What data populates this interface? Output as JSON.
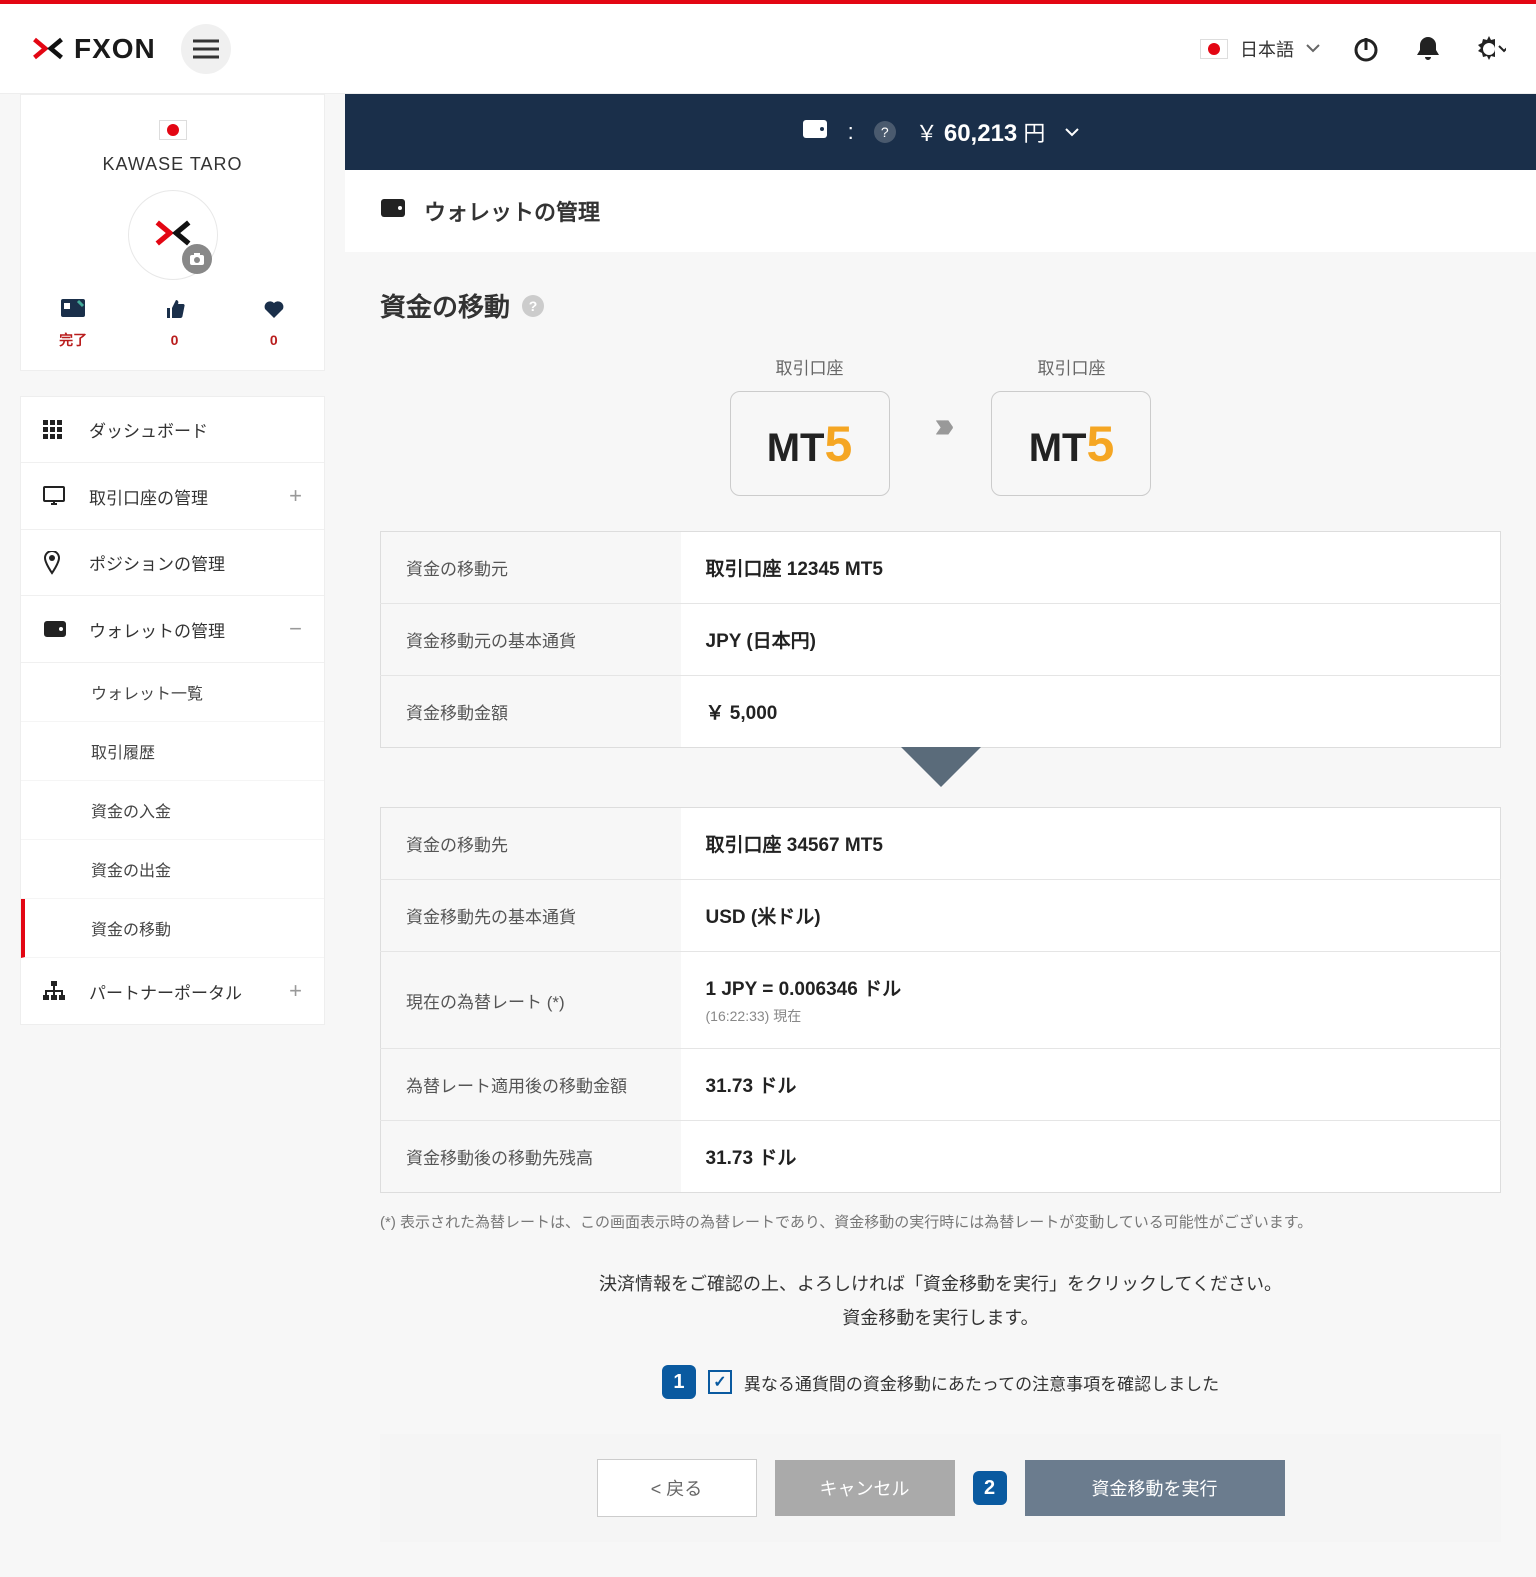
{
  "header": {
    "brand": "FXON",
    "language": "日本語"
  },
  "profile": {
    "name": "KAWASE TARO",
    "stats": {
      "complete_label": "完了",
      "thumbs": "0",
      "hearts": "0"
    }
  },
  "nav": {
    "dashboard": "ダッシュボード",
    "accounts": "取引口座の管理",
    "positions": "ポジションの管理",
    "wallet": "ウォレットの管理",
    "partner": "パートナーポータル",
    "sub": {
      "wallet_list": "ウォレット一覧",
      "history": "取引履歴",
      "deposit": "資金の入金",
      "withdrawal": "資金の出金",
      "transfer": "資金の移動"
    }
  },
  "balance": {
    "colon": ":",
    "currency_symbol": "￥",
    "amount": "60,213",
    "currency": "円"
  },
  "page": {
    "title": "ウォレットの管理",
    "section_title": "資金の移動"
  },
  "transfer": {
    "source_label": "取引口座",
    "dest_label": "取引口座",
    "platform_prefix": "MT",
    "platform_num": "5"
  },
  "source_table": {
    "account_label": "資金の移動元",
    "account_value": "取引口座 12345 MT5",
    "currency_label": "資金移動元の基本通貨",
    "currency_value": "JPY (日本円)",
    "amount_label": "資金移動金額",
    "amount_value": "￥ 5,000"
  },
  "dest_table": {
    "account_label": "資金の移動先",
    "account_value": "取引口座 34567 MT5",
    "currency_label": "資金移動先の基本通貨",
    "currency_value": "USD (米ドル)",
    "rate_label": "現在の為替レート (*)",
    "rate_value": "1 JPY = 0.006346 ドル",
    "rate_time": "(16:22:33) 現在",
    "converted_label": "為替レート適用後の移動金額",
    "converted_value": "31.73 ドル",
    "balance_label": "資金移動後の移動先残高",
    "balance_value": "31.73 ドル"
  },
  "note": "(*)   表示された為替レートは、この画面表示時の為替レートであり、資金移動の実行時には為替レートが変動している可能性がございます。",
  "confirm": {
    "line1": "決済情報をご確認の上、よろしければ「資金移動を実行」をクリックしてください。",
    "line2": "資金移動を実行します。",
    "badge1": "1",
    "checkbox_label": "異なる通貨間の資金移動にあたっての注意事項を確認しました",
    "badge2": "2"
  },
  "buttons": {
    "back": "< 戻る",
    "cancel": "キャンセル",
    "submit": "資金移動を実行"
  }
}
